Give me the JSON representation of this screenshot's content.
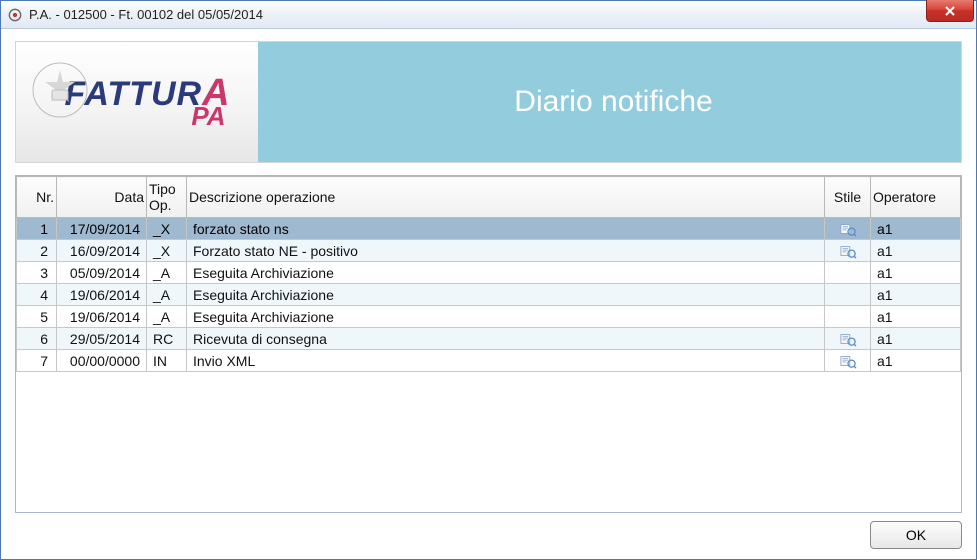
{
  "window": {
    "title": "P.A. - 012500 - Ft. 00102 del 05/05/2014"
  },
  "banner": {
    "logo_main": "FATTUR",
    "logo_a": "A",
    "logo_sub": "PA",
    "title": "Diario notifiche"
  },
  "table": {
    "headers": {
      "nr": "Nr.",
      "data": "Data",
      "tipo": "Tipo Op.",
      "desc": "Descrizione operazione",
      "stile": "Stile",
      "oper": "Operatore"
    },
    "rows": [
      {
        "nr": "1",
        "data": "17/09/2014",
        "tipo": "_X",
        "desc": "forzato stato ns",
        "stile": true,
        "oper": "a1",
        "selected": true
      },
      {
        "nr": "2",
        "data": "16/09/2014",
        "tipo": "_X",
        "desc": "Forzato stato NE - positivo",
        "stile": true,
        "oper": "a1"
      },
      {
        "nr": "3",
        "data": "05/09/2014",
        "tipo": "_A",
        "desc": "Eseguita Archiviazione",
        "stile": false,
        "oper": "a1"
      },
      {
        "nr": "4",
        "data": "19/06/2014",
        "tipo": "_A",
        "desc": "Eseguita Archiviazione",
        "stile": false,
        "oper": "a1"
      },
      {
        "nr": "5",
        "data": "19/06/2014",
        "tipo": "_A",
        "desc": "Eseguita Archiviazione",
        "stile": false,
        "oper": "a1"
      },
      {
        "nr": "6",
        "data": "29/05/2014",
        "tipo": "RC",
        "desc": "Ricevuta di consegna",
        "stile": true,
        "oper": "a1"
      },
      {
        "nr": "7",
        "data": "00/00/0000",
        "tipo": "IN",
        "desc": "Invio XML",
        "stile": true,
        "oper": "a1"
      }
    ]
  },
  "footer": {
    "ok_label": "OK"
  }
}
